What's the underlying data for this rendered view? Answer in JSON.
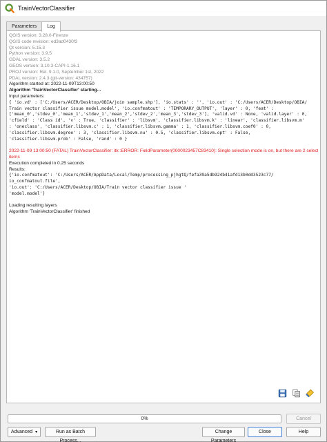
{
  "window": {
    "title": "TrainVectorClassifier",
    "icon": "qgis-logo-icon"
  },
  "tabs": [
    {
      "label": "Parameters",
      "active": false
    },
    {
      "label": "Log",
      "active": true
    }
  ],
  "log": {
    "info_lines": [
      "QGIS version: 3.28.0-Firenze",
      "QGIS code revision: ed3ad0430f3",
      "Qt version: 5.15.3",
      "Python version: 3.9.5",
      "GDAL version: 3.5.2",
      "GEOS version: 3.10.3-CAPI-1.16.1",
      "PROJ version: Rel. 9.1.0, September 1st, 2022",
      "PDAL version: 2.4.3 (git-version: 434757)"
    ],
    "started": "Algorithm started at: 2022-11-09T13:00:50",
    "starting": "Algorithm 'TrainVectorClassifier' starting...",
    "input_header": "Input parameters:",
    "param_lines": [
      "{ 'io.vd' : ['C:/Users/ACER/Desktop/OBIA/join sample.shp'], 'io.stats' : '', 'io.out' : 'C:/Users/ACER/Desktop/OBIA/",
      "Train vector classifier issue model.model', 'io.confmatout' : 'TEMPORARY_OUTPUT', 'layer' : 0, 'feat' :",
      "['mean_0','stdev_0','mean_1','stdev_1','mean_2','stdev_2','mean_3','stdev_3'], 'valid.vd' : None, 'valid.layer' : 0,",
      "'cfield' : 'Class id', 'v' : True, 'classifier' : 'libsvm', 'classifier.libsvm.k' : 'linear', 'classifier.libsvm.m'",
      ": 'oneclass', 'classifier.libsvm.c' : 1, 'classifier.libsvm.gamma' : 1, 'classifier.libsvm.coef0' : 0,",
      "'classifier.libsvm.degree' : 3, 'classifier.libsvm.nu' : 0.5, 'classifier.libsvm.opt' : False,",
      "'classifier.libsvm.prob' : False, 'rand' : 0 }"
    ],
    "error_lines": [
      "2022-11-09 13:00:50 (FATAL) TrainVectorClassifier: itk::ERROR: FieldParameter(0000023457C83410): Single selection mode is on, but there are 2 selected",
      "items"
    ],
    "completed": "Execution completed in 0.25 seconds",
    "results_header": "Results:",
    "result_lines": [
      "{'io.confmatout': 'C:/Users/ACER/AppData/Local/Temp/processing_pjhgtQ/fefa39a5db924b41afd13b0dd3523c77/",
      "io_confmatout.file',",
      " 'io.out': 'C:/Users/ACER/Desktop/OBIA/Train vector classifier issue '",
      " 'model.model'}"
    ],
    "loading": "Loading resulting layers",
    "finished": "Algorithm 'TrainVectorClassifier' finished"
  },
  "panel_icons": [
    "save-log-icon",
    "copy-log-icon",
    "clear-log-icon"
  ],
  "progress": {
    "value": 0,
    "label": "0%"
  },
  "buttons": {
    "cancel": "Cancel",
    "advanced": "Advanced",
    "batch": "Run as Batch Process...",
    "change_params": "Change Parameters",
    "close": "Close",
    "help": "Help"
  },
  "colors": {
    "error": "#e02020",
    "info": "#8a8a8a",
    "accent": "#3c7fd6"
  }
}
